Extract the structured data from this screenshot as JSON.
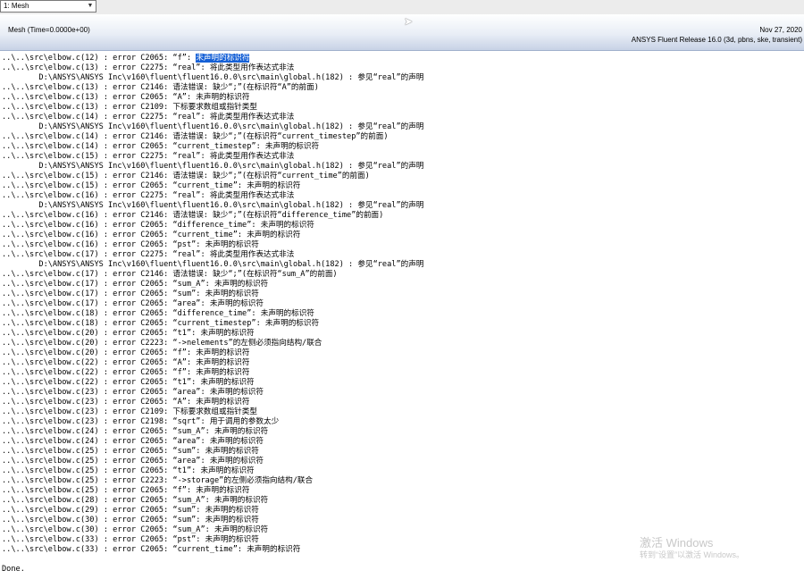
{
  "dropdown": {
    "value": "1: Mesh"
  },
  "header": {
    "left": "Mesh  (Time=0.0000e+00)",
    "date": "Nov 27, 2020",
    "release": "ANSYS Fluent Release 16.0 (3d, pbns, ske, transient)"
  },
  "console": {
    "lines": [
      {
        "text": "..\\..\\src\\elbow.c(12) : error C2065: “f”: ",
        "hl": "未声明的标识符"
      },
      {
        "text": "..\\..\\src\\elbow.c(13) : error C2275: “real”: 将此类型用作表达式非法"
      },
      {
        "text": "        D:\\ANSYS\\ANSYS Inc\\v160\\fluent\\fluent16.0.0\\src\\main\\global.h(182) : 参见“real”的声明"
      },
      {
        "text": "..\\..\\src\\elbow.c(13) : error C2146: 语法错误: 缺少“;”(在标识符“A”的前面)"
      },
      {
        "text": "..\\..\\src\\elbow.c(13) : error C2065: “A”: 未声明的标识符"
      },
      {
        "text": "..\\..\\src\\elbow.c(13) : error C2109: 下标要求数组或指针类型"
      },
      {
        "text": "..\\..\\src\\elbow.c(14) : error C2275: “real”: 将此类型用作表达式非法"
      },
      {
        "text": "        D:\\ANSYS\\ANSYS Inc\\v160\\fluent\\fluent16.0.0\\src\\main\\global.h(182) : 参见“real”的声明"
      },
      {
        "text": "..\\..\\src\\elbow.c(14) : error C2146: 语法错误: 缺少“;”(在标识符“current_timestep”的前面)"
      },
      {
        "text": "..\\..\\src\\elbow.c(14) : error C2065: “current_timestep”: 未声明的标识符"
      },
      {
        "text": "..\\..\\src\\elbow.c(15) : error C2275: “real”: 将此类型用作表达式非法"
      },
      {
        "text": "        D:\\ANSYS\\ANSYS Inc\\v160\\fluent\\fluent16.0.0\\src\\main\\global.h(182) : 参见“real”的声明"
      },
      {
        "text": "..\\..\\src\\elbow.c(15) : error C2146: 语法错误: 缺少“;”(在标识符“current_time”的前面)"
      },
      {
        "text": "..\\..\\src\\elbow.c(15) : error C2065: “current_time”: 未声明的标识符"
      },
      {
        "text": "..\\..\\src\\elbow.c(16) : error C2275: “real”: 将此类型用作表达式非法"
      },
      {
        "text": "        D:\\ANSYS\\ANSYS Inc\\v160\\fluent\\fluent16.0.0\\src\\main\\global.h(182) : 参见“real”的声明"
      },
      {
        "text": "..\\..\\src\\elbow.c(16) : error C2146: 语法错误: 缺少“;”(在标识符“difference_time”的前面)"
      },
      {
        "text": "..\\..\\src\\elbow.c(16) : error C2065: “difference_time”: 未声明的标识符"
      },
      {
        "text": "..\\..\\src\\elbow.c(16) : error C2065: “current_time”: 未声明的标识符"
      },
      {
        "text": "..\\..\\src\\elbow.c(16) : error C2065: “pst”: 未声明的标识符"
      },
      {
        "text": "..\\..\\src\\elbow.c(17) : error C2275: “real”: 将此类型用作表达式非法"
      },
      {
        "text": "        D:\\ANSYS\\ANSYS Inc\\v160\\fluent\\fluent16.0.0\\src\\main\\global.h(182) : 参见“real”的声明"
      },
      {
        "text": "..\\..\\src\\elbow.c(17) : error C2146: 语法错误: 缺少“;”(在标识符“sum_A”的前面)"
      },
      {
        "text": "..\\..\\src\\elbow.c(17) : error C2065: “sum_A”: 未声明的标识符"
      },
      {
        "text": "..\\..\\src\\elbow.c(17) : error C2065: “sum”: 未声明的标识符"
      },
      {
        "text": "..\\..\\src\\elbow.c(17) : error C2065: “area”: 未声明的标识符"
      },
      {
        "text": "..\\..\\src\\elbow.c(18) : error C2065: “difference_time”: 未声明的标识符"
      },
      {
        "text": "..\\..\\src\\elbow.c(18) : error C2065: “current_timestep”: 未声明的标识符"
      },
      {
        "text": "..\\..\\src\\elbow.c(20) : error C2065: “t1”: 未声明的标识符"
      },
      {
        "text": "..\\..\\src\\elbow.c(20) : error C2223: “->nelements”的左侧必须指向结构/联合"
      },
      {
        "text": "..\\..\\src\\elbow.c(20) : error C2065: “f”: 未声明的标识符"
      },
      {
        "text": "..\\..\\src\\elbow.c(22) : error C2065: “A”: 未声明的标识符"
      },
      {
        "text": "..\\..\\src\\elbow.c(22) : error C2065: “f”: 未声明的标识符"
      },
      {
        "text": "..\\..\\src\\elbow.c(22) : error C2065: “t1”: 未声明的标识符"
      },
      {
        "text": "..\\..\\src\\elbow.c(23) : error C2065: “area”: 未声明的标识符"
      },
      {
        "text": "..\\..\\src\\elbow.c(23) : error C2065: “A”: 未声明的标识符"
      },
      {
        "text": "..\\..\\src\\elbow.c(23) : error C2109: 下标要求数组或指针类型"
      },
      {
        "text": "..\\..\\src\\elbow.c(23) : error C2198: “sqrt”: 用于调用的参数太少"
      },
      {
        "text": "..\\..\\src\\elbow.c(24) : error C2065: “sum_A”: 未声明的标识符"
      },
      {
        "text": "..\\..\\src\\elbow.c(24) : error C2065: “area”: 未声明的标识符"
      },
      {
        "text": "..\\..\\src\\elbow.c(25) : error C2065: “sum”: 未声明的标识符"
      },
      {
        "text": "..\\..\\src\\elbow.c(25) : error C2065: “area”: 未声明的标识符"
      },
      {
        "text": "..\\..\\src\\elbow.c(25) : error C2065: “t1”: 未声明的标识符"
      },
      {
        "text": "..\\..\\src\\elbow.c(25) : error C2223: “->storage”的左侧必须指向结构/联合"
      },
      {
        "text": "..\\..\\src\\elbow.c(25) : error C2065: “f”: 未声明的标识符"
      },
      {
        "text": "..\\..\\src\\elbow.c(28) : error C2065: “sum_A”: 未声明的标识符"
      },
      {
        "text": "..\\..\\src\\elbow.c(29) : error C2065: “sum”: 未声明的标识符"
      },
      {
        "text": "..\\..\\src\\elbow.c(30) : error C2065: “sum”: 未声明的标识符"
      },
      {
        "text": "..\\..\\src\\elbow.c(30) : error C2065: “sum_A”: 未声明的标识符"
      },
      {
        "text": "..\\..\\src\\elbow.c(33) : error C2065: “pst”: 未声明的标识符"
      },
      {
        "text": "..\\..\\src\\elbow.c(33) : error C2065: “current_time”: 未声明的标识符"
      }
    ],
    "done": "Done."
  },
  "watermark": {
    "title": "激活 Windows",
    "subtitle": "转到“设置”以激活 Windows。"
  },
  "colors": {
    "selection": "#1560d6",
    "header_bottom": "#c7d2e6"
  }
}
